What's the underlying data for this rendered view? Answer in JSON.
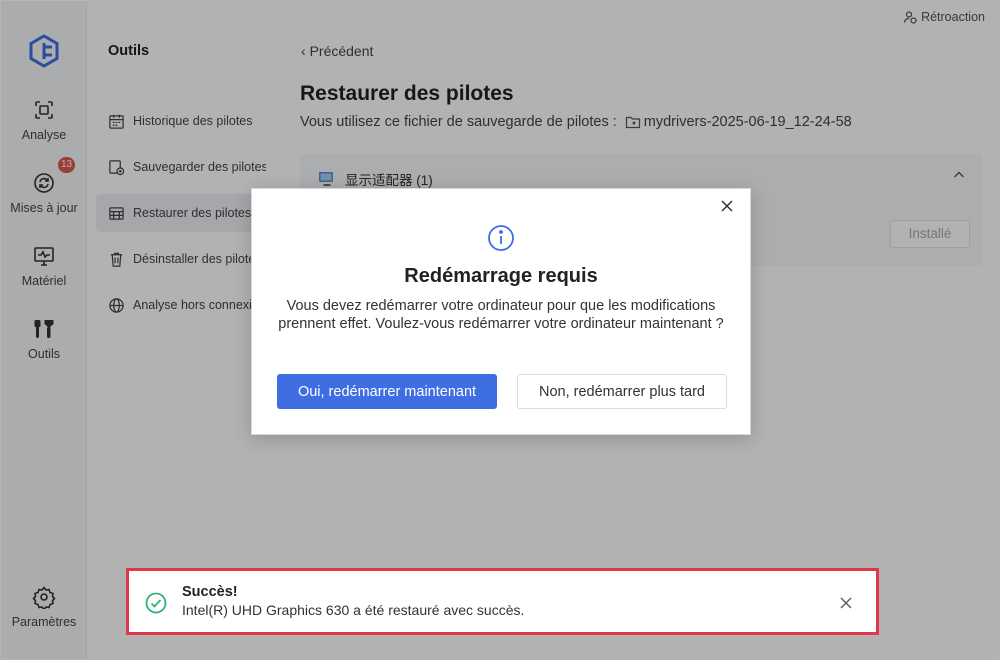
{
  "feedback": {
    "label": "Rétroaction",
    "icon": "feedback-user-icon"
  },
  "rail": {
    "items": [
      {
        "label": "Analyse",
        "icon": "scan-icon"
      },
      {
        "label": "Mises à jour",
        "icon": "refresh-icon",
        "badge": "13"
      },
      {
        "label": "Matériel",
        "icon": "hardware-monitor-icon"
      },
      {
        "label": "Outils",
        "icon": "tools-icon"
      }
    ],
    "settings": {
      "label": "Paramètres",
      "icon": "gear-icon"
    }
  },
  "sidebar": {
    "title": "Outils",
    "items": [
      {
        "label": "Historique des pilotes",
        "icon": "calendar-icon"
      },
      {
        "label": "Sauvegarder des pilotes",
        "icon": "backup-icon"
      },
      {
        "label": "Restaurer des pilotes",
        "icon": "restore-icon",
        "active": true
      },
      {
        "label": "Désinstaller des pilotes",
        "icon": "trash-icon"
      },
      {
        "label": "Analyse hors connexion",
        "icon": "globe-icon"
      }
    ]
  },
  "main": {
    "back_label": "Précédent",
    "title": "Restaurer des pilotes",
    "file_prefix": "Vous utilisez ce fichier de sauvegarde de pilotes :",
    "file_name": "mydrivers-2025-06-19_12-24-58",
    "category": "显示适配器 (1)",
    "installed_label": "Installé"
  },
  "modal": {
    "title": "Redémarrage requis",
    "message": "Vous devez redémarrer votre ordinateur pour que les modifications prennent effet. Voulez-vous redémarrer votre ordinateur maintenant ?",
    "primary_label": "Oui, redémarrer maintenant",
    "secondary_label": "Non, redémarrer plus tard"
  },
  "toast": {
    "title": "Succès!",
    "message": "Intel(R) UHD Graphics 630 a été restauré avec succès."
  },
  "colors": {
    "primary": "#3f6ee3",
    "badge": "#e05a4f",
    "success": "#2db37a",
    "highlight_border": "#e0384a"
  }
}
